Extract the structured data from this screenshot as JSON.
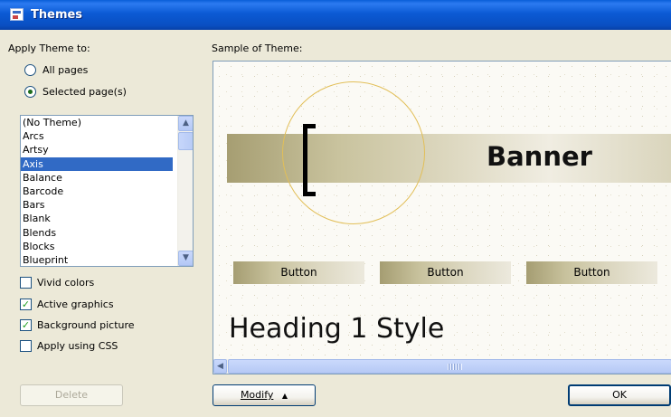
{
  "window": {
    "title": "Themes"
  },
  "apply": {
    "heading": "Apply Theme to:",
    "options": [
      {
        "label": "All pages",
        "selected": false
      },
      {
        "label": "Selected page(s)",
        "selected": true
      }
    ]
  },
  "themes": {
    "items": [
      "(No Theme)",
      "Arcs",
      "Artsy",
      "Axis",
      "Balance",
      "Barcode",
      "Bars",
      "Blank",
      "Blends",
      "Blocks",
      "Blueprint"
    ],
    "selected": "Axis"
  },
  "options": [
    {
      "label": "Vivid colors",
      "checked": false
    },
    {
      "label": "Active graphics",
      "checked": true
    },
    {
      "label": "Background picture",
      "checked": true
    },
    {
      "label": "Apply using CSS",
      "checked": false
    }
  ],
  "sample": {
    "heading": "Sample of Theme:",
    "banner": "Banner",
    "buttons": [
      "Button",
      "Button",
      "Button"
    ],
    "heading1": "Heading 1 Style"
  },
  "buttons": {
    "delete": "Delete",
    "modify": "Modify",
    "ok": "OK"
  },
  "colors": {
    "title_bar": "#0a5fd8",
    "selection": "#316ac5",
    "dialog_bg": "#ece9d8",
    "circle": "#e2bf58"
  }
}
